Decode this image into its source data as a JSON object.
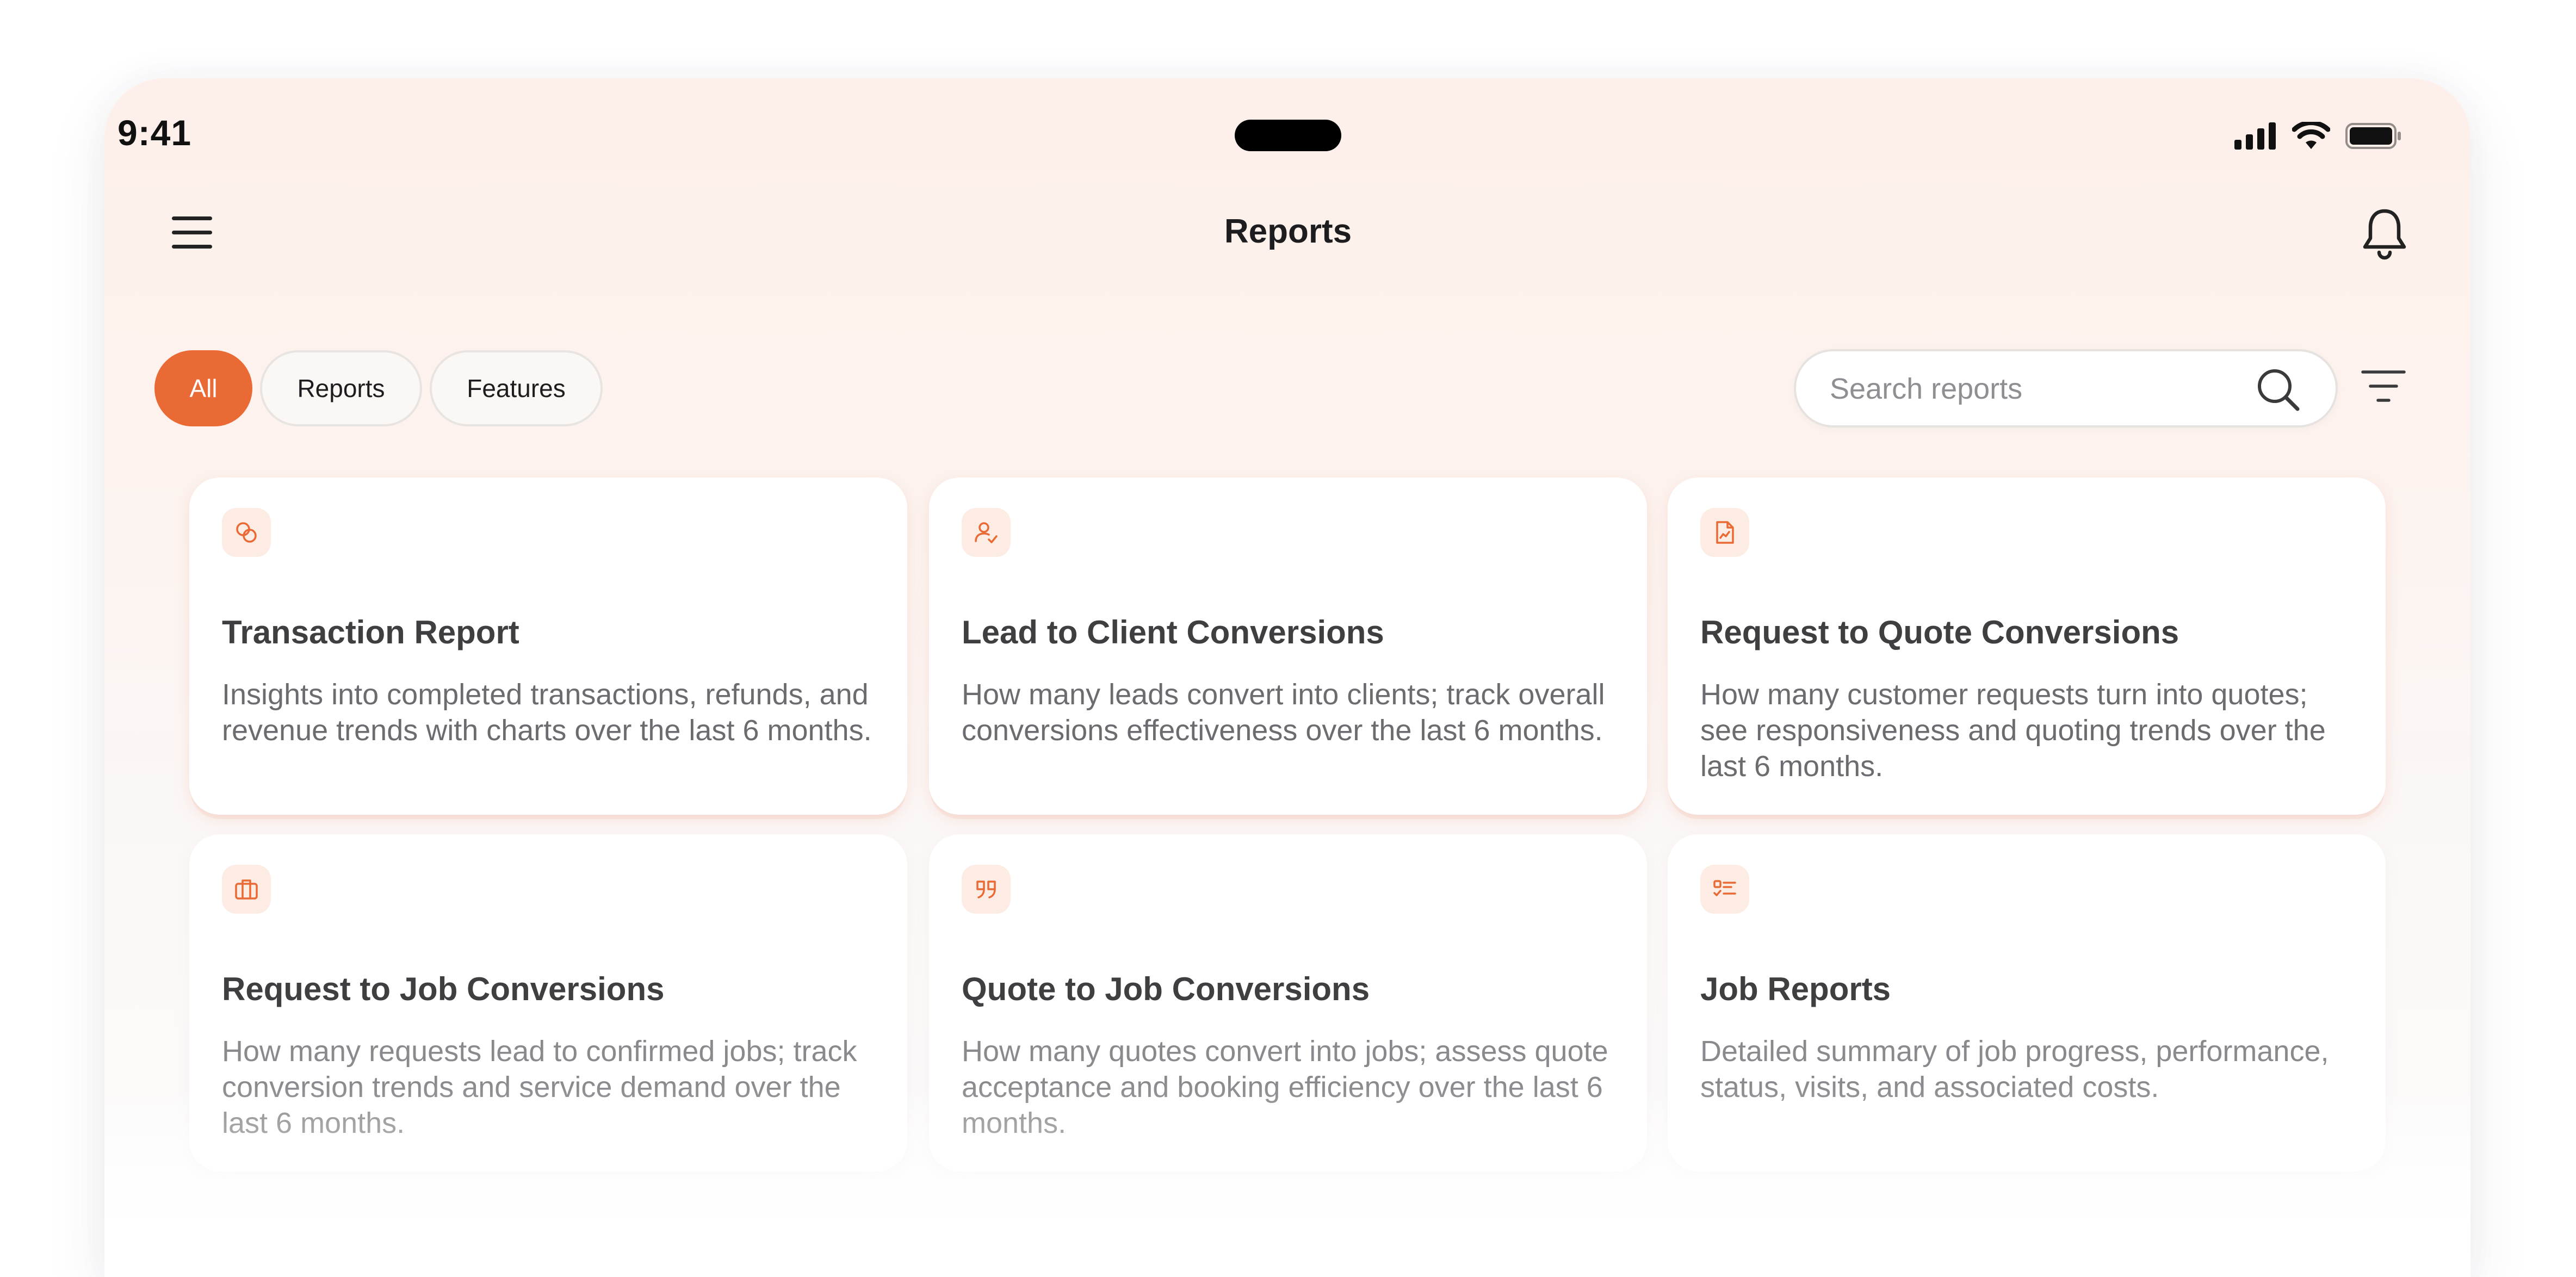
{
  "status_bar": {
    "time": "9:41",
    "icons": [
      "cellular-signal-icon",
      "wifi-icon",
      "battery-icon"
    ]
  },
  "header": {
    "title": "Reports",
    "menu_icon": "hamburger-menu-icon",
    "notification_icon": "bell-icon"
  },
  "filters": {
    "chips": [
      {
        "label": "All",
        "active": true
      },
      {
        "label": "Reports",
        "active": false
      },
      {
        "label": "Features",
        "active": false
      }
    ],
    "filter_icon": "filter-lines-icon"
  },
  "search": {
    "placeholder": "Search reports",
    "value": "",
    "icon": "search-icon"
  },
  "cards": [
    {
      "icon": "coins-icon",
      "title": "Transaction Report",
      "description": "Insights into completed transactions, refunds, and revenue trends with charts over the last 6 months."
    },
    {
      "icon": "user-check-icon",
      "title": "Lead to Client Conversions",
      "description": "How many leads convert into clients; track overall conversions effectiveness over the last 6 months."
    },
    {
      "icon": "document-chart-icon",
      "title": "Request to Quote Conversions",
      "description": "How many customer requests turn into quotes; see responsiveness and quoting trends over the last 6 months."
    },
    {
      "icon": "briefcase-icon",
      "title": "Request to Job Conversions",
      "description": "How many requests lead to confirmed jobs; track conversion trends and service demand over the last 6 months."
    },
    {
      "icon": "quote-marks-icon",
      "title": "Quote to Job Conversions",
      "description": "How many quotes convert into jobs; assess quote acceptance and booking efficiency over the last 6 months."
    },
    {
      "icon": "checklist-icon",
      "title": "Job Reports",
      "description": "Detailed summary of job progress, performance, status, visits, and associated costs."
    }
  ],
  "colors": {
    "accent": "#ea6a35",
    "icon_bg": "#fdece4",
    "title_text": "#3f3f42",
    "body_text": "#6b6b70"
  }
}
